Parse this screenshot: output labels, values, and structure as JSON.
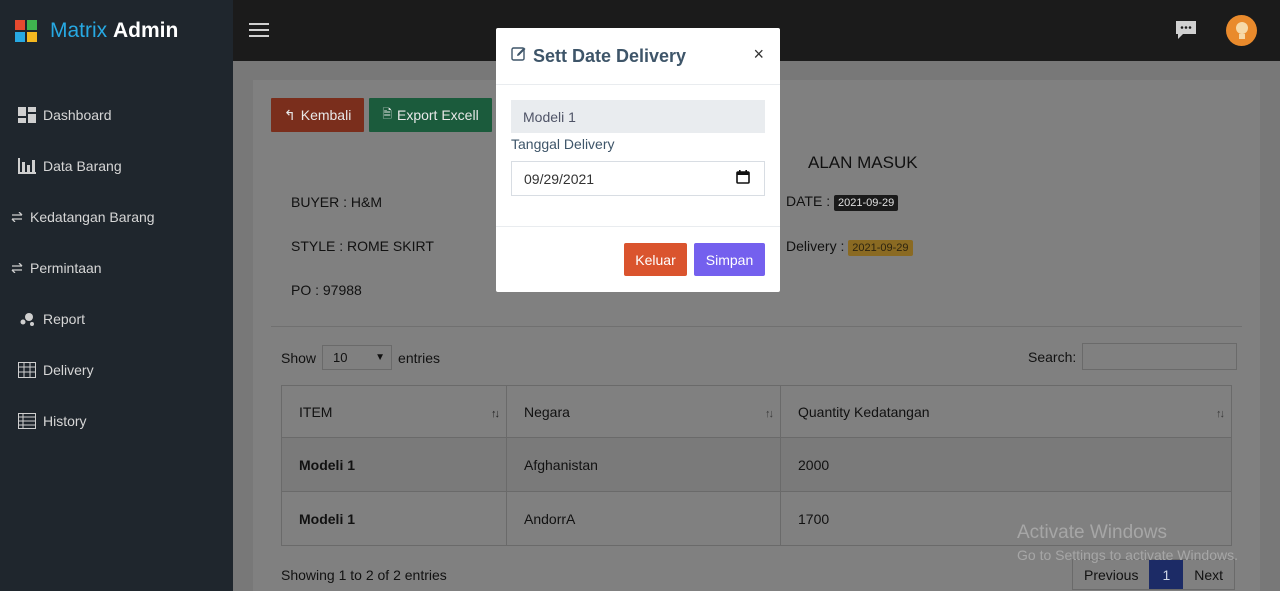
{
  "brand": {
    "light": "Matrix",
    "bold": "Admin"
  },
  "sidebar": {
    "items": [
      {
        "label": "Dashboard",
        "icon": "dashboard-icon"
      },
      {
        "label": "Data Barang",
        "icon": "bar-chart-icon"
      },
      {
        "label": "Kedatangan Barang",
        "icon": "swap-icon"
      },
      {
        "label": "Permintaan",
        "icon": "swap-icon"
      },
      {
        "label": "Report",
        "icon": "scatter-icon"
      },
      {
        "label": "Delivery",
        "icon": "grid-icon"
      },
      {
        "label": "History",
        "icon": "table-icon"
      }
    ]
  },
  "toolbar": {
    "back_label": "Kembali",
    "export_label": "Export Excell"
  },
  "page": {
    "heading": "ALAN MASUK",
    "buyer": "BUYER : H&M",
    "style": "STYLE : ROME SKIRT",
    "po": "PO : 97988",
    "date_label": "DATE :",
    "date_value": "2021-09-29",
    "delivery_label": "Delivery :",
    "delivery_value": "2021-09-29"
  },
  "table": {
    "show_label": "Show",
    "entries_label": "entries",
    "length_value": "10",
    "search_label": "Search:",
    "columns": [
      "ITEM",
      "Negara",
      "Quantity Kedatangan"
    ],
    "rows": [
      [
        "Modeli 1",
        "Afghanistan",
        "2000"
      ],
      [
        "Modeli 1",
        "AndorrA",
        "1700"
      ]
    ],
    "info": "Showing 1 to 2 of 2 entries",
    "pagination": {
      "previous": "Previous",
      "current": "1",
      "next": "Next"
    }
  },
  "modal": {
    "title": "Sett Date Delivery",
    "close": "×",
    "item_value": "Modeli 1",
    "date_label": "Tanggal Delivery",
    "date_value": "09/29/2021",
    "cancel_label": "Keluar",
    "save_label": "Simpan"
  },
  "watermark": {
    "line1": "Activate Windows",
    "line2": "Go to Settings to activate Windows."
  },
  "colors": {
    "sidebar": "#1f262d",
    "accent_blue": "#27a9e3",
    "danger": "#da542e",
    "primary": "#7460ee"
  }
}
